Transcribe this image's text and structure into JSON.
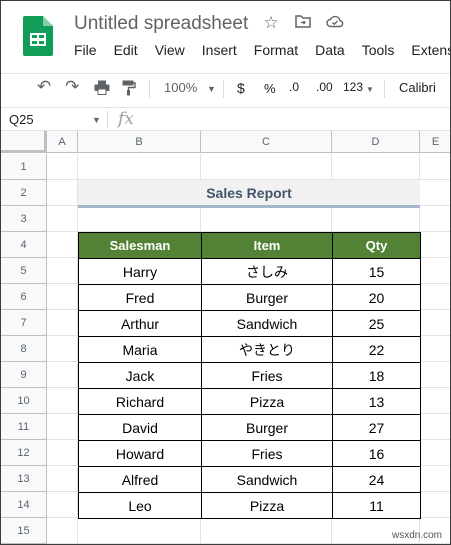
{
  "app": {
    "doc_title": "Untitled spreadsheet",
    "title_icons": [
      "star-icon",
      "move-to-folder-icon",
      "cloud-status-icon"
    ],
    "brand_color": "#0f9d58"
  },
  "menu": [
    "File",
    "Edit",
    "View",
    "Insert",
    "Format",
    "Data",
    "Tools",
    "Extensio"
  ],
  "toolbar": {
    "undo": "↶",
    "redo": "↷",
    "print": "🖶",
    "paint": "🖌",
    "zoom": "100%",
    "currency": "$",
    "percent": "%",
    "dec_decrease": ".0",
    "dec_increase": ".00",
    "number_format": "123",
    "font": "Calibri"
  },
  "formula_bar": {
    "cell_ref": "Q25",
    "fx": "fx"
  },
  "grid": {
    "columns": [
      "A",
      "B",
      "C",
      "D",
      "E"
    ],
    "rows": [
      "1",
      "2",
      "3",
      "4",
      "5",
      "6",
      "7",
      "8",
      "9",
      "10",
      "11",
      "12",
      "13",
      "14",
      "15"
    ]
  },
  "report": {
    "title": "Sales Report",
    "headers": [
      "Salesman",
      "Item",
      "Qty"
    ],
    "header_color": "#538135",
    "rows": [
      [
        "Harry",
        "さしみ",
        "15"
      ],
      [
        "Fred",
        "Burger",
        "20"
      ],
      [
        "Arthur",
        "Sandwich",
        "25"
      ],
      [
        "Maria",
        "やきとり",
        "22"
      ],
      [
        "Jack",
        "Fries",
        "18"
      ],
      [
        "Richard",
        "Pizza",
        "13"
      ],
      [
        "David",
        "Burger",
        "27"
      ],
      [
        "Howard",
        "Fries",
        "16"
      ],
      [
        "Alfred",
        "Sandwich",
        "24"
      ],
      [
        "Leo",
        "Pizza",
        "11"
      ]
    ]
  },
  "watermark": "wsxdn.com"
}
